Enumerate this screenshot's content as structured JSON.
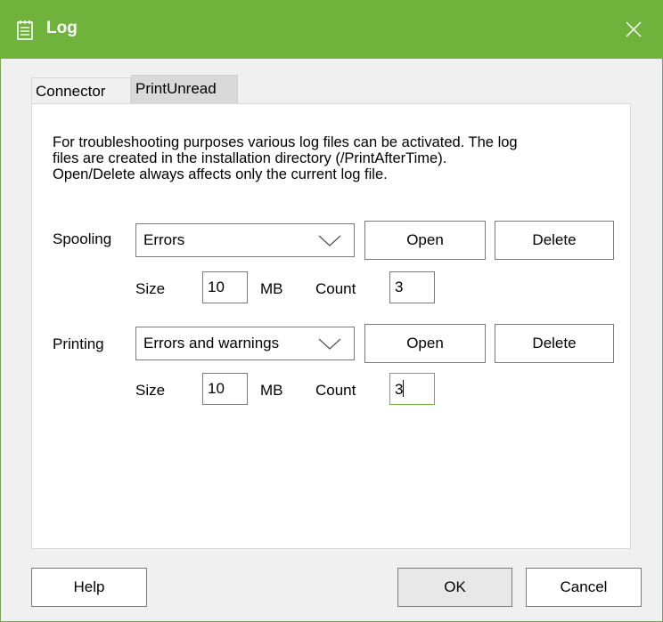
{
  "window": {
    "title": "Log",
    "icon": "notepad-icon",
    "close_icon": "close-icon"
  },
  "tabs": [
    {
      "label": "Connector",
      "active": false
    },
    {
      "label": "PrintUnread",
      "active": true
    }
  ],
  "description": [
    "For troubleshooting purposes various log files can be activated. The log",
    "files are created in the installation directory (/PrintAfterTime).",
    "Open/Delete always affects only the current log file."
  ],
  "spooling": {
    "label": "Spooling",
    "level": "Errors",
    "open_label": "Open",
    "delete_label": "Delete",
    "size_label": "Size",
    "size_value": "10",
    "unit_label": "MB",
    "count_label": "Count",
    "count_value": "3"
  },
  "printing": {
    "label": "Printing",
    "level": "Errors and warnings",
    "open_label": "Open",
    "delete_label": "Delete",
    "size_label": "Size",
    "size_value": "10",
    "unit_label": "MB",
    "count_label": "Count",
    "count_value": "3"
  },
  "footer": {
    "help_label": "Help",
    "ok_label": "OK",
    "cancel_label": "Cancel"
  },
  "colors": {
    "titlebar": "#6fb33c",
    "focus_border": "#6fb33c"
  }
}
